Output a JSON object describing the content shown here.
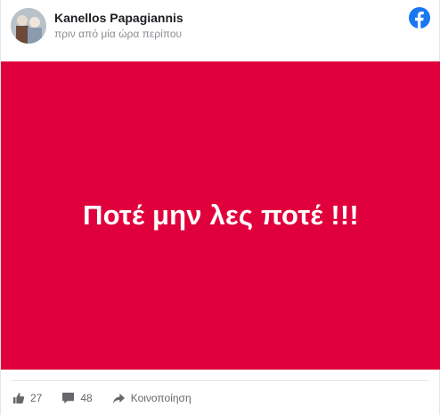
{
  "post": {
    "author": "Kanellos Papagiannis",
    "timestamp": "πριν από μία ώρα περίπου",
    "logo_icon": "facebook-logo-icon",
    "brand_color": "#1877f2",
    "banner": {
      "text": "Ποτέ μην λες ποτέ !!!",
      "background_color": "#e0003c"
    },
    "footer": {
      "like_count": "27",
      "comment_count": "48",
      "share_label": "Κοινοποίηση",
      "icons": [
        "like-icon",
        "comment-icon",
        "share-icon"
      ]
    }
  }
}
